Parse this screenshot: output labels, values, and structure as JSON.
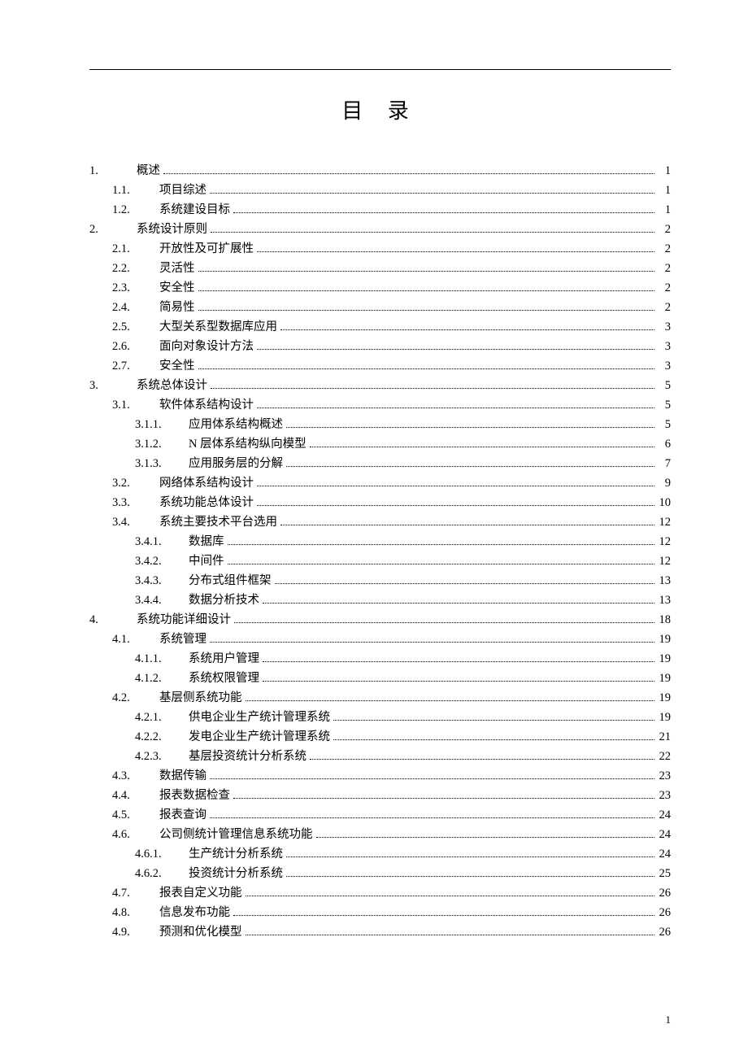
{
  "title": "目 录",
  "footer_page": "1",
  "toc": [
    {
      "level": 0,
      "num": "1.",
      "label": "概述",
      "page": "1"
    },
    {
      "level": 1,
      "num": "1.1.",
      "label": "项目综述",
      "page": "1"
    },
    {
      "level": 1,
      "num": "1.2.",
      "label": "系统建设目标",
      "page": "1"
    },
    {
      "level": 0,
      "num": "2.",
      "label": "系统设计原则",
      "page": "2"
    },
    {
      "level": 1,
      "num": "2.1.",
      "label": "开放性及可扩展性",
      "page": "2"
    },
    {
      "level": 1,
      "num": "2.2.",
      "label": "灵活性",
      "page": "2"
    },
    {
      "level": 1,
      "num": "2.3.",
      "label": "安全性",
      "page": "2"
    },
    {
      "level": 1,
      "num": "2.4.",
      "label": "简易性",
      "page": "2"
    },
    {
      "level": 1,
      "num": "2.5.",
      "label": "大型关系型数据库应用",
      "page": "3"
    },
    {
      "level": 1,
      "num": "2.6.",
      "label": "面向对象设计方法",
      "page": "3"
    },
    {
      "level": 1,
      "num": "2.7.",
      "label": "安全性",
      "page": "3"
    },
    {
      "level": 0,
      "num": "3.",
      "label": "系统总体设计",
      "page": "5"
    },
    {
      "level": 1,
      "num": "3.1.",
      "label": "软件体系结构设计",
      "page": "5"
    },
    {
      "level": 2,
      "num": "3.1.1.",
      "label": "应用体系结构概述",
      "page": "5"
    },
    {
      "level": 2,
      "num": "3.1.2.",
      "label": "N 层体系结构纵向模型",
      "page": "6"
    },
    {
      "level": 2,
      "num": "3.1.3.",
      "label": "应用服务层的分解",
      "page": "7"
    },
    {
      "level": 1,
      "num": "3.2.",
      "label": "网络体系结构设计",
      "page": "9"
    },
    {
      "level": 1,
      "num": "3.3.",
      "label": "系统功能总体设计",
      "page": "10"
    },
    {
      "level": 1,
      "num": "3.4.",
      "label": "系统主要技术平台选用",
      "page": "12"
    },
    {
      "level": 2,
      "num": "3.4.1.",
      "label": "数据库",
      "page": "12"
    },
    {
      "level": 2,
      "num": "3.4.2.",
      "label": "中间件",
      "page": "12"
    },
    {
      "level": 2,
      "num": "3.4.3.",
      "label": "分布式组件框架",
      "page": "13"
    },
    {
      "level": 2,
      "num": "3.4.4.",
      "label": "数据分析技术",
      "page": "13"
    },
    {
      "level": 0,
      "num": "4.",
      "label": "系统功能详细设计",
      "page": "18"
    },
    {
      "level": 1,
      "num": "4.1.",
      "label": "系统管理",
      "page": "19"
    },
    {
      "level": 2,
      "num": "4.1.1.",
      "label": "系统用户管理",
      "page": "19"
    },
    {
      "level": 2,
      "num": "4.1.2.",
      "label": "系统权限管理",
      "page": "19"
    },
    {
      "level": 1,
      "num": "4.2.",
      "label": "基层侧系统功能",
      "page": "19"
    },
    {
      "level": 2,
      "num": "4.2.1.",
      "label": "供电企业生产统计管理系统",
      "page": "19"
    },
    {
      "level": 2,
      "num": "4.2.2.",
      "label": "发电企业生产统计管理系统",
      "page": "21"
    },
    {
      "level": 2,
      "num": "4.2.3.",
      "label": "基层投资统计分析系统",
      "page": "22"
    },
    {
      "level": 1,
      "num": "4.3.",
      "label": "数据传输",
      "page": "23"
    },
    {
      "level": 1,
      "num": "4.4.",
      "label": "报表数据检查",
      "page": "23"
    },
    {
      "level": 1,
      "num": "4.5.",
      "label": "报表查询",
      "page": "24"
    },
    {
      "level": 1,
      "num": "4.6.",
      "label": "公司侧统计管理信息系统功能",
      "page": "24"
    },
    {
      "level": 2,
      "num": "4.6.1.",
      "label": "生产统计分析系统",
      "page": "24"
    },
    {
      "level": 2,
      "num": "4.6.2.",
      "label": "投资统计分析系统",
      "page": "25"
    },
    {
      "level": 1,
      "num": "4.7.",
      "label": "报表自定义功能",
      "page": "26"
    },
    {
      "level": 1,
      "num": "4.8.",
      "label": "信息发布功能",
      "page": "26"
    },
    {
      "level": 1,
      "num": "4.9.",
      "label": "预测和优化模型",
      "page": "26"
    }
  ]
}
